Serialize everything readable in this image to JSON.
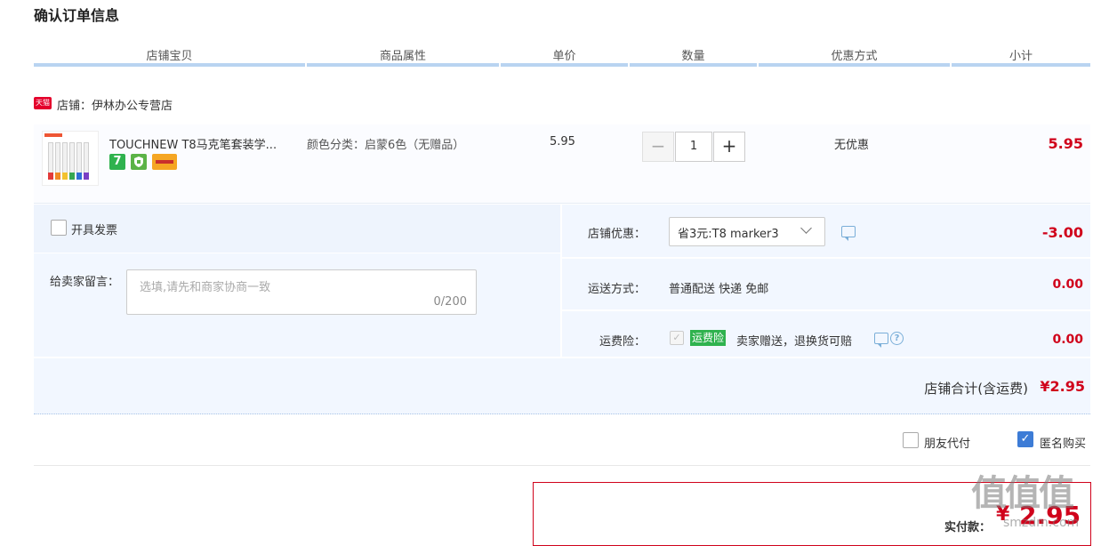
{
  "page": {
    "title": "确认订单信息"
  },
  "table": {
    "headers": [
      "店铺宝贝",
      "商品属性",
      "单价",
      "数量",
      "优惠方式",
      "小计"
    ]
  },
  "shop": {
    "badge": "天猫",
    "name": "店铺：伊林办公专营店"
  },
  "item": {
    "name": "TOUCHNEW T8马克笔套装学...",
    "badge_7": "7",
    "attribute": "颜色分类：启蒙6色（无赠品）",
    "unit_price": "5.95",
    "quantity": "1",
    "qty_minus": "−",
    "qty_plus": "+",
    "discount": "无优惠",
    "subtotal": "5.95",
    "pen_colors": [
      "#e23a3a",
      "#f08a24",
      "#f2c12e",
      "#36a852",
      "#2f6fd6",
      "#7a3fc4"
    ]
  },
  "invoice": {
    "label": "开具发票"
  },
  "message": {
    "label": "给卖家留言：",
    "placeholder": "选填,请先和商家协商一致",
    "count": "0/200"
  },
  "shop_discount": {
    "label": "店铺优惠：",
    "selected": "省3元:T8 marker3",
    "amount": "-3.00"
  },
  "shipping": {
    "label": "运送方式：",
    "value": "普通配送 快递 免邮",
    "amount": "0.00"
  },
  "insurance": {
    "label": "运费险：",
    "badge": "运费险",
    "text": "卖家赠送，退换货可赔",
    "amount": "0.00"
  },
  "shop_total": {
    "label": "店铺合计(含运费)",
    "value": "¥2.95"
  },
  "options": {
    "friend_pay": "朋友代付",
    "anonymous": "匿名购买"
  },
  "payment": {
    "label": "实付款：",
    "currency": "¥",
    "value": "2.95"
  },
  "watermark": {
    "text": "值值值",
    "sub": "smzdm.com"
  },
  "colors": {
    "accent_red": "#d0021b",
    "header_line": "#b9d4f1",
    "panel_bg": "#f2f7ff",
    "check_blue": "#3d7cd6",
    "badge_green": "#2fb24e"
  }
}
